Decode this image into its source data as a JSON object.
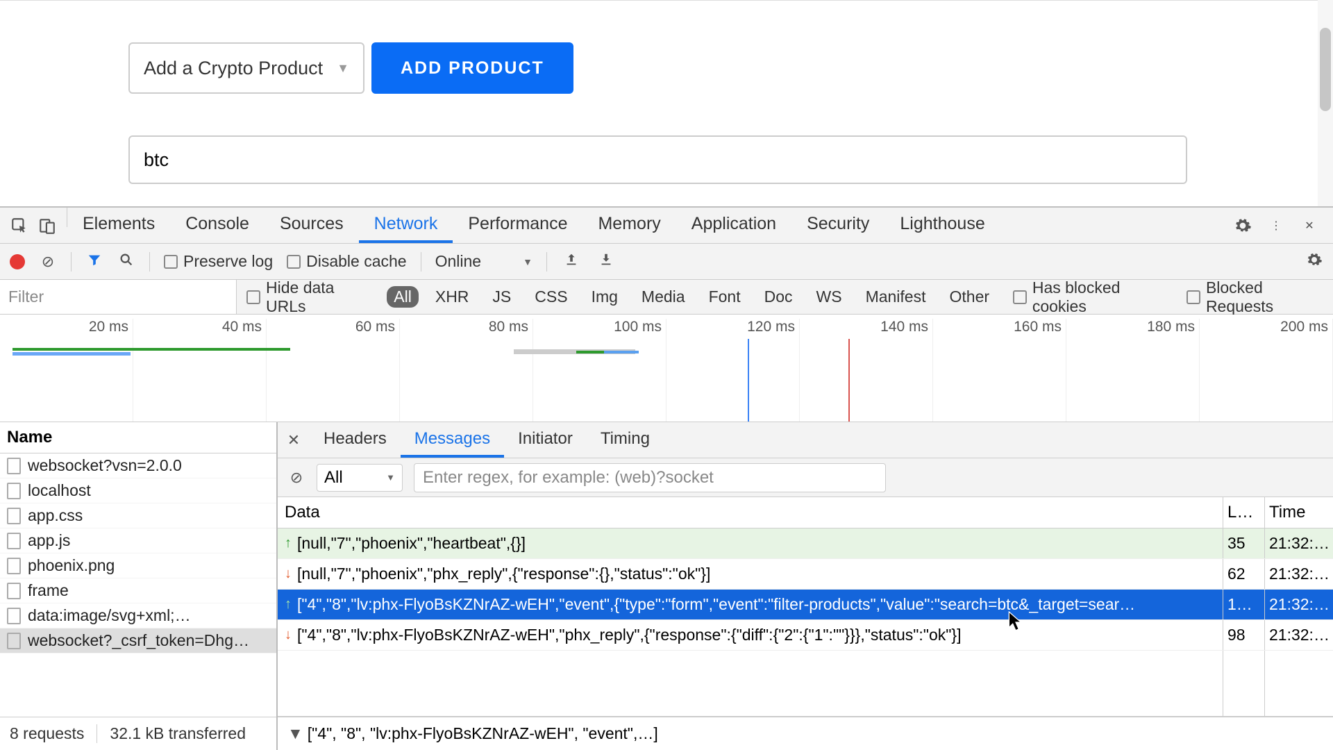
{
  "app": {
    "crypto_select_label": "Add a Crypto Product",
    "add_button": "ADD PRODUCT",
    "search_value": "btc"
  },
  "devtools": {
    "tabs": [
      "Elements",
      "Console",
      "Sources",
      "Network",
      "Performance",
      "Memory",
      "Application",
      "Security",
      "Lighthouse"
    ],
    "active_tab": "Network",
    "preserve_log": "Preserve log",
    "disable_cache": "Disable cache",
    "online": "Online",
    "filter_placeholder": "Filter",
    "hide_data_urls": "Hide data URLs",
    "types": [
      "All",
      "XHR",
      "JS",
      "CSS",
      "Img",
      "Media",
      "Font",
      "Doc",
      "WS",
      "Manifest",
      "Other"
    ],
    "has_blocked_cookies": "Has blocked cookies",
    "blocked_requests": "Blocked Requests",
    "timeline_ticks": [
      "20 ms",
      "40 ms",
      "60 ms",
      "80 ms",
      "100 ms",
      "120 ms",
      "140 ms",
      "160 ms",
      "180 ms",
      "200 ms"
    ]
  },
  "requests": {
    "header": "Name",
    "items": [
      "websocket?vsn=2.0.0",
      "localhost",
      "app.css",
      "app.js",
      "phoenix.png",
      "frame",
      "data:image/svg+xml;…",
      "websocket?_csrf_token=Dhg…"
    ],
    "selected_index": 7,
    "footer_requests": "8 requests",
    "footer_transferred": "32.1 kB transferred"
  },
  "detail": {
    "tabs": [
      "Headers",
      "Messages",
      "Initiator",
      "Timing"
    ],
    "active_tab": "Messages",
    "filter_all": "All",
    "regex_placeholder": "Enter regex, for example: (web)?socket",
    "columns": {
      "data": "Data",
      "len": "L…",
      "time": "Time"
    },
    "messages": [
      {
        "dir": "up",
        "data": "[null,\"7\",\"phoenix\",\"heartbeat\",{}]",
        "len": "35",
        "time": "21:32:…"
      },
      {
        "dir": "down",
        "data": "[null,\"7\",\"phoenix\",\"phx_reply\",{\"response\":{},\"status\":\"ok\"}]",
        "len": "62",
        "time": "21:32:…"
      },
      {
        "dir": "up",
        "data": "[\"4\",\"8\",\"lv:phx-FlyoBsKZNrAZ-wEH\",\"event\",{\"type\":\"form\",\"event\":\"filter-products\",\"value\":\"search=btc&_target=sear…",
        "len": "1…",
        "time": "21:32:…",
        "selected": true
      },
      {
        "dir": "down",
        "data": "[\"4\",\"8\",\"lv:phx-FlyoBsKZNrAZ-wEH\",\"phx_reply\",{\"response\":{\"diff\":{\"2\":{\"1\":\"\"}}},\"status\":\"ok\"}]",
        "len": "98",
        "time": "21:32:…"
      }
    ],
    "preview": "[\"4\", \"8\", \"lv:phx-FlyoBsKZNrAZ-wEH\", \"event\",…]"
  }
}
